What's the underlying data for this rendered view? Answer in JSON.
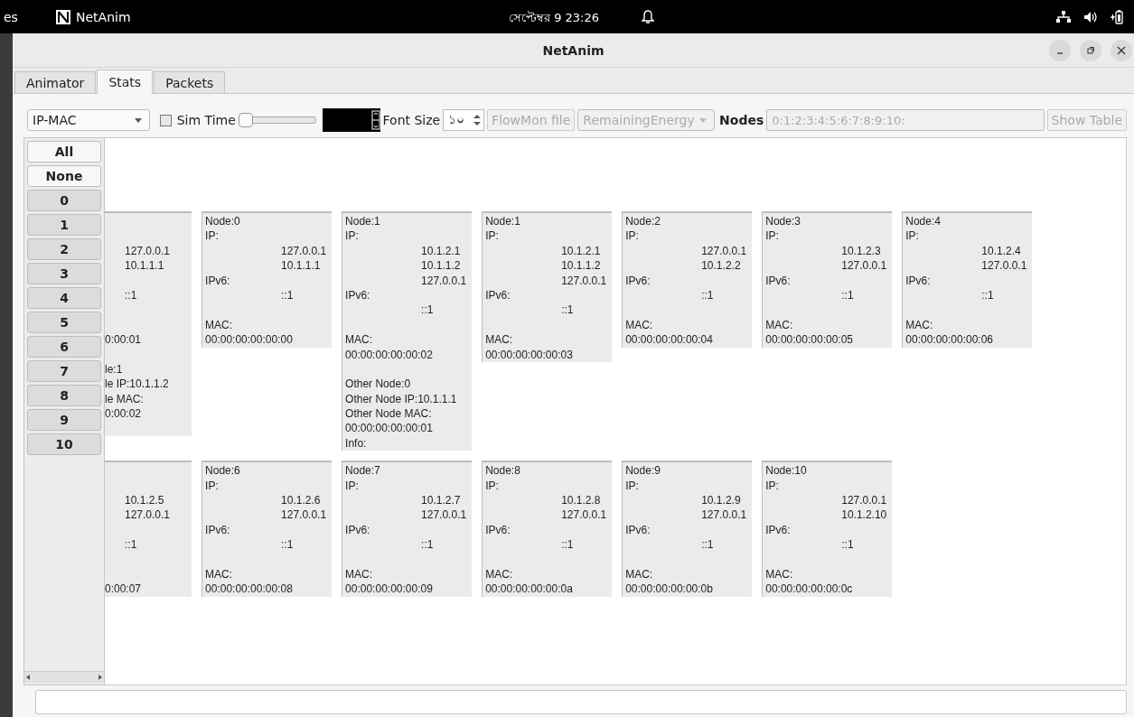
{
  "top_bar": {
    "activities": "es",
    "app_name": "NetAnim",
    "clock": "সেপ্টেম্বর 9  23:26"
  },
  "window": {
    "title": "NetAnim"
  },
  "tabs": [
    {
      "label": "Animator",
      "selected": false
    },
    {
      "label": "Stats",
      "selected": true
    },
    {
      "label": "Packets",
      "selected": false
    }
  ],
  "toolbar": {
    "mode_combo": {
      "value": "IP-MAC",
      "disabled": false
    },
    "sim_time": {
      "label": "Sim Time",
      "checked": false,
      "level": 0
    },
    "font_size": {
      "label": "Font Size",
      "value": "১০"
    },
    "flowmon_button": {
      "label": "FlowMon file",
      "disabled": true
    },
    "metric_combo": {
      "value": "RemainingEnergy",
      "disabled": true
    },
    "nodes": {
      "label": "Nodes",
      "value": "0:1:2:3:4:5:6:7:8:9:10:",
      "disabled": true
    },
    "show_table_button": {
      "label": "Show Table",
      "disabled": true
    }
  },
  "node_actions": [
    "All",
    "None"
  ],
  "node_buttons": [
    {
      "label": "0",
      "selected": true
    },
    {
      "label": "1",
      "selected": true
    },
    {
      "label": "2",
      "selected": true
    },
    {
      "label": "3",
      "selected": true
    },
    {
      "label": "4",
      "selected": true
    },
    {
      "label": "5",
      "selected": true
    },
    {
      "label": "6",
      "selected": true
    },
    {
      "label": "7",
      "selected": true
    },
    {
      "label": "8",
      "selected": true
    },
    {
      "label": "9",
      "selected": true
    },
    {
      "label": "10",
      "selected": true
    }
  ],
  "card_rows": [
    [
      {
        "clipped": true,
        "lines": [
          {
            "kind": "blank"
          },
          {
            "kind": "blank"
          },
          {
            "kind": "value",
            "text": "127.0.0.1"
          },
          {
            "kind": "value",
            "text": "10.1.1.1"
          },
          {
            "kind": "blank"
          },
          {
            "kind": "value",
            "text": "::1"
          },
          {
            "kind": "blank"
          },
          {
            "kind": "blank"
          },
          {
            "kind": "label",
            "text": "0:00:01"
          },
          {
            "kind": "blank"
          },
          {
            "kind": "label",
            "text": "le:1"
          },
          {
            "kind": "label",
            "text": "le IP:10.1.1.2"
          },
          {
            "kind": "label",
            "text": "le MAC:"
          },
          {
            "kind": "label",
            "text": "0:00:02"
          },
          {
            "kind": "blank"
          }
        ]
      },
      {
        "clipped": false,
        "lines": [
          {
            "kind": "label",
            "text": "Node:0"
          },
          {
            "kind": "label",
            "text": "IP:"
          },
          {
            "kind": "value",
            "text": "127.0.0.1"
          },
          {
            "kind": "value",
            "text": "10.1.1.1"
          },
          {
            "kind": "label",
            "text": "IPv6:"
          },
          {
            "kind": "value",
            "text": "::1"
          },
          {
            "kind": "blank"
          },
          {
            "kind": "label",
            "text": "MAC:"
          },
          {
            "kind": "label",
            "text": "00:00:00:00:00:00"
          }
        ]
      },
      {
        "clipped": false,
        "lines": [
          {
            "kind": "label",
            "text": "Node:1"
          },
          {
            "kind": "label",
            "text": "IP:"
          },
          {
            "kind": "value",
            "text": "10.1.2.1"
          },
          {
            "kind": "value",
            "text": "10.1.1.2"
          },
          {
            "kind": "value",
            "text": "127.0.0.1"
          },
          {
            "kind": "label",
            "text": "IPv6:"
          },
          {
            "kind": "value",
            "text": "::1"
          },
          {
            "kind": "blank"
          },
          {
            "kind": "label",
            "text": "MAC:"
          },
          {
            "kind": "label",
            "text": "00:00:00:00:00:02"
          },
          {
            "kind": "blank"
          },
          {
            "kind": "label",
            "text": "Other Node:0"
          },
          {
            "kind": "label",
            "text": "Other Node IP:10.1.1.1"
          },
          {
            "kind": "label",
            "text": "Other Node MAC:"
          },
          {
            "kind": "label",
            "text": "00:00:00:00:00:01"
          },
          {
            "kind": "label",
            "text": "Info:"
          }
        ]
      },
      {
        "clipped": false,
        "lines": [
          {
            "kind": "label",
            "text": "Node:1"
          },
          {
            "kind": "label",
            "text": "IP:"
          },
          {
            "kind": "value",
            "text": "10.1.2.1"
          },
          {
            "kind": "value",
            "text": "10.1.1.2"
          },
          {
            "kind": "value",
            "text": "127.0.0.1"
          },
          {
            "kind": "label",
            "text": "IPv6:"
          },
          {
            "kind": "value",
            "text": "::1"
          },
          {
            "kind": "blank"
          },
          {
            "kind": "label",
            "text": "MAC:"
          },
          {
            "kind": "label",
            "text": "00:00:00:00:00:03"
          }
        ]
      },
      {
        "clipped": false,
        "lines": [
          {
            "kind": "label",
            "text": "Node:2"
          },
          {
            "kind": "label",
            "text": "IP:"
          },
          {
            "kind": "value",
            "text": "127.0.0.1"
          },
          {
            "kind": "value",
            "text": "10.1.2.2"
          },
          {
            "kind": "label",
            "text": "IPv6:"
          },
          {
            "kind": "value",
            "text": "::1"
          },
          {
            "kind": "blank"
          },
          {
            "kind": "label",
            "text": "MAC:"
          },
          {
            "kind": "label",
            "text": "00:00:00:00:00:04"
          }
        ]
      },
      {
        "clipped": false,
        "lines": [
          {
            "kind": "label",
            "text": "Node:3"
          },
          {
            "kind": "label",
            "text": "IP:"
          },
          {
            "kind": "value",
            "text": "10.1.2.3"
          },
          {
            "kind": "value",
            "text": "127.0.0.1"
          },
          {
            "kind": "label",
            "text": "IPv6:"
          },
          {
            "kind": "value",
            "text": "::1"
          },
          {
            "kind": "blank"
          },
          {
            "kind": "label",
            "text": "MAC:"
          },
          {
            "kind": "label",
            "text": "00:00:00:00:00:05"
          }
        ]
      },
      {
        "clipped": false,
        "lines": [
          {
            "kind": "label",
            "text": "Node:4"
          },
          {
            "kind": "label",
            "text": "IP:"
          },
          {
            "kind": "value",
            "text": "10.1.2.4"
          },
          {
            "kind": "value",
            "text": "127.0.0.1"
          },
          {
            "kind": "label",
            "text": "IPv6:"
          },
          {
            "kind": "value",
            "text": "::1"
          },
          {
            "kind": "blank"
          },
          {
            "kind": "label",
            "text": "MAC:"
          },
          {
            "kind": "label",
            "text": "00:00:00:00:00:06"
          }
        ]
      }
    ],
    [
      {
        "clipped": true,
        "lines": [
          {
            "kind": "blank"
          },
          {
            "kind": "blank"
          },
          {
            "kind": "value",
            "text": "10.1.2.5"
          },
          {
            "kind": "value",
            "text": "127.0.0.1"
          },
          {
            "kind": "blank"
          },
          {
            "kind": "value",
            "text": "::1"
          },
          {
            "kind": "blank"
          },
          {
            "kind": "blank"
          },
          {
            "kind": "label",
            "text": "0:00:07"
          }
        ]
      },
      {
        "clipped": false,
        "lines": [
          {
            "kind": "label",
            "text": "Node:6"
          },
          {
            "kind": "label",
            "text": "IP:"
          },
          {
            "kind": "value",
            "text": "10.1.2.6"
          },
          {
            "kind": "value",
            "text": "127.0.0.1"
          },
          {
            "kind": "label",
            "text": "IPv6:"
          },
          {
            "kind": "value",
            "text": "::1"
          },
          {
            "kind": "blank"
          },
          {
            "kind": "label",
            "text": "MAC:"
          },
          {
            "kind": "label",
            "text": "00:00:00:00:00:08"
          }
        ]
      },
      {
        "clipped": false,
        "lines": [
          {
            "kind": "label",
            "text": "Node:7"
          },
          {
            "kind": "label",
            "text": "IP:"
          },
          {
            "kind": "value",
            "text": "10.1.2.7"
          },
          {
            "kind": "value",
            "text": "127.0.0.1"
          },
          {
            "kind": "label",
            "text": "IPv6:"
          },
          {
            "kind": "value",
            "text": "::1"
          },
          {
            "kind": "blank"
          },
          {
            "kind": "label",
            "text": "MAC:"
          },
          {
            "kind": "label",
            "text": "00:00:00:00:00:09"
          }
        ]
      },
      {
        "clipped": false,
        "lines": [
          {
            "kind": "label",
            "text": "Node:8"
          },
          {
            "kind": "label",
            "text": "IP:"
          },
          {
            "kind": "value",
            "text": "10.1.2.8"
          },
          {
            "kind": "value",
            "text": "127.0.0.1"
          },
          {
            "kind": "label",
            "text": "IPv6:"
          },
          {
            "kind": "value",
            "text": "::1"
          },
          {
            "kind": "blank"
          },
          {
            "kind": "label",
            "text": "MAC:"
          },
          {
            "kind": "label",
            "text": "00:00:00:00:00:0a"
          }
        ]
      },
      {
        "clipped": false,
        "lines": [
          {
            "kind": "label",
            "text": "Node:9"
          },
          {
            "kind": "label",
            "text": "IP:"
          },
          {
            "kind": "value",
            "text": "10.1.2.9"
          },
          {
            "kind": "value",
            "text": "127.0.0.1"
          },
          {
            "kind": "label",
            "text": "IPv6:"
          },
          {
            "kind": "value",
            "text": "::1"
          },
          {
            "kind": "blank"
          },
          {
            "kind": "label",
            "text": "MAC:"
          },
          {
            "kind": "label",
            "text": "00:00:00:00:00:0b"
          }
        ]
      },
      {
        "clipped": false,
        "lines": [
          {
            "kind": "label",
            "text": "Node:10"
          },
          {
            "kind": "label",
            "text": "IP:"
          },
          {
            "kind": "value",
            "text": "127.0.0.1"
          },
          {
            "kind": "value",
            "text": "10.1.2.10"
          },
          {
            "kind": "label",
            "text": "IPv6:"
          },
          {
            "kind": "value",
            "text": "::1"
          },
          {
            "kind": "blank"
          },
          {
            "kind": "label",
            "text": "MAC:"
          },
          {
            "kind": "label",
            "text": "00:00:00:00:00:0c"
          }
        ]
      }
    ]
  ]
}
